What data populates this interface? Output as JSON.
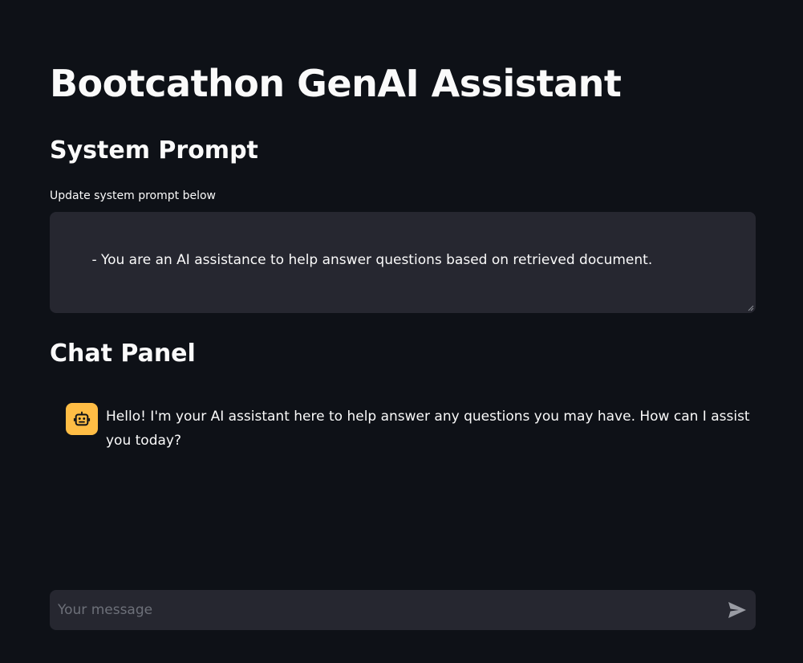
{
  "header": {
    "title": "Bootcathon GenAI Assistant"
  },
  "system_prompt": {
    "section_title": "System Prompt",
    "label": "Update system prompt below",
    "value": "- You are an AI assistance to help answer questions based on retrieved document."
  },
  "chat": {
    "section_title": "Chat Panel",
    "messages": [
      {
        "role": "assistant",
        "avatar_icon": "robot-icon",
        "text": "Hello! I'm your AI assistant here to help answer any questions you may have. How can I assist you today?"
      }
    ],
    "input": {
      "placeholder": "Your message",
      "value": "",
      "send_icon": "send-icon"
    }
  },
  "colors": {
    "background": "#0e1117",
    "surface": "#262730",
    "text": "#fafafa",
    "placeholder": "#6d7079",
    "avatar_bg": "#ffbd45",
    "send_icon": "#9a9ca4"
  }
}
